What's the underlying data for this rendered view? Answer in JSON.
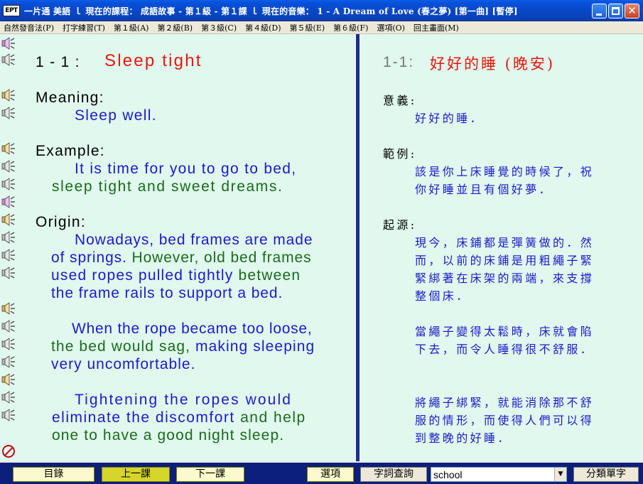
{
  "window": {
    "app_icon_text": "EPT",
    "title": "一片通 美語 ｌ 現在的課程： 成語故事 - 第１級 - 第１課 ｌ 現在的音樂： 1 - A Dream of Love (春之夢) [第一曲] [暫停]",
    "close_glyph": "✕"
  },
  "menu": [
    "自然發音法(P)",
    "打字練習(T)",
    "第１級(A)",
    "第２級(B)",
    "第３級(C)",
    "第４級(D)",
    "第５級(E)",
    "第６級(F)",
    "選項(O)",
    "回主畫面(M)"
  ],
  "lesson_en": {
    "number": "1 - 1 :",
    "title": "Sleep tight",
    "meaning_label": "Meaning:",
    "meaning": "Sleep well.",
    "example_label": "Example:",
    "example_1": "It is time for you to go to bed,",
    "example_2": "sleep tight and sweet dreams.",
    "origin_label": "Origin:",
    "o1_a": "Nowadays, bed frames are made",
    "o1_b1": "of springs.",
    "o1_b2": " However, old bed frames",
    "o1_c1": "used ropes pulled tightly",
    "o1_c2": " between",
    "o1_d": "the frame rails to support a bed.",
    "o2_a": "When the rope became too loose,",
    "o2_b1": "the bed would sag,",
    "o2_b2": " making sleeping",
    "o2_c": "very uncomfortable.",
    "o3_a": "Tightening the ropes would",
    "o3_b1": "eliminate the discomfort",
    "o3_b2": " and help",
    "o3_c": "one to have a good night sleep."
  },
  "lesson_zh": {
    "number": "1-1:",
    "title": "好好的睡 (晚安)",
    "meaning_label": "意義:",
    "meaning": "好好的睡．",
    "example_label": "範例:",
    "example_1": "該是你上床睡覺的時候了，祝",
    "example_2": "你好睡並且有個好夢．",
    "origin_label": "起源:",
    "o1_a": "現今，床鋪都是彈簧做的．然",
    "o1_b": "而，以前的床鋪是用粗繩子緊",
    "o1_c": "緊綁著在床架的兩端，來支撐",
    "o1_d": "整個床．",
    "o2_a": "當繩子變得太鬆時，床就會陷",
    "o2_b": "下去，而令人睡得很不舒服．",
    "o3_a": "將繩子綁緊，就能消除那不舒",
    "o3_b": "服的情形，而使得人們可以得",
    "o3_c": "到整晚的好睡．"
  },
  "toolbar": {
    "contents": "目錄",
    "prev": "上一課",
    "next": "下一課",
    "options": "選項",
    "dictionary": "字詞查詢",
    "search_value": "school",
    "dropdown_glyph": "▼",
    "category_words": "分類單字"
  },
  "colors": {
    "pane_bg": "#e0f8ee",
    "accent_red": "#e8160c",
    "text_blue": "#1b1bc8",
    "text_green": "#1a6b1a",
    "toolbar_bg": "#0c1f7a"
  }
}
